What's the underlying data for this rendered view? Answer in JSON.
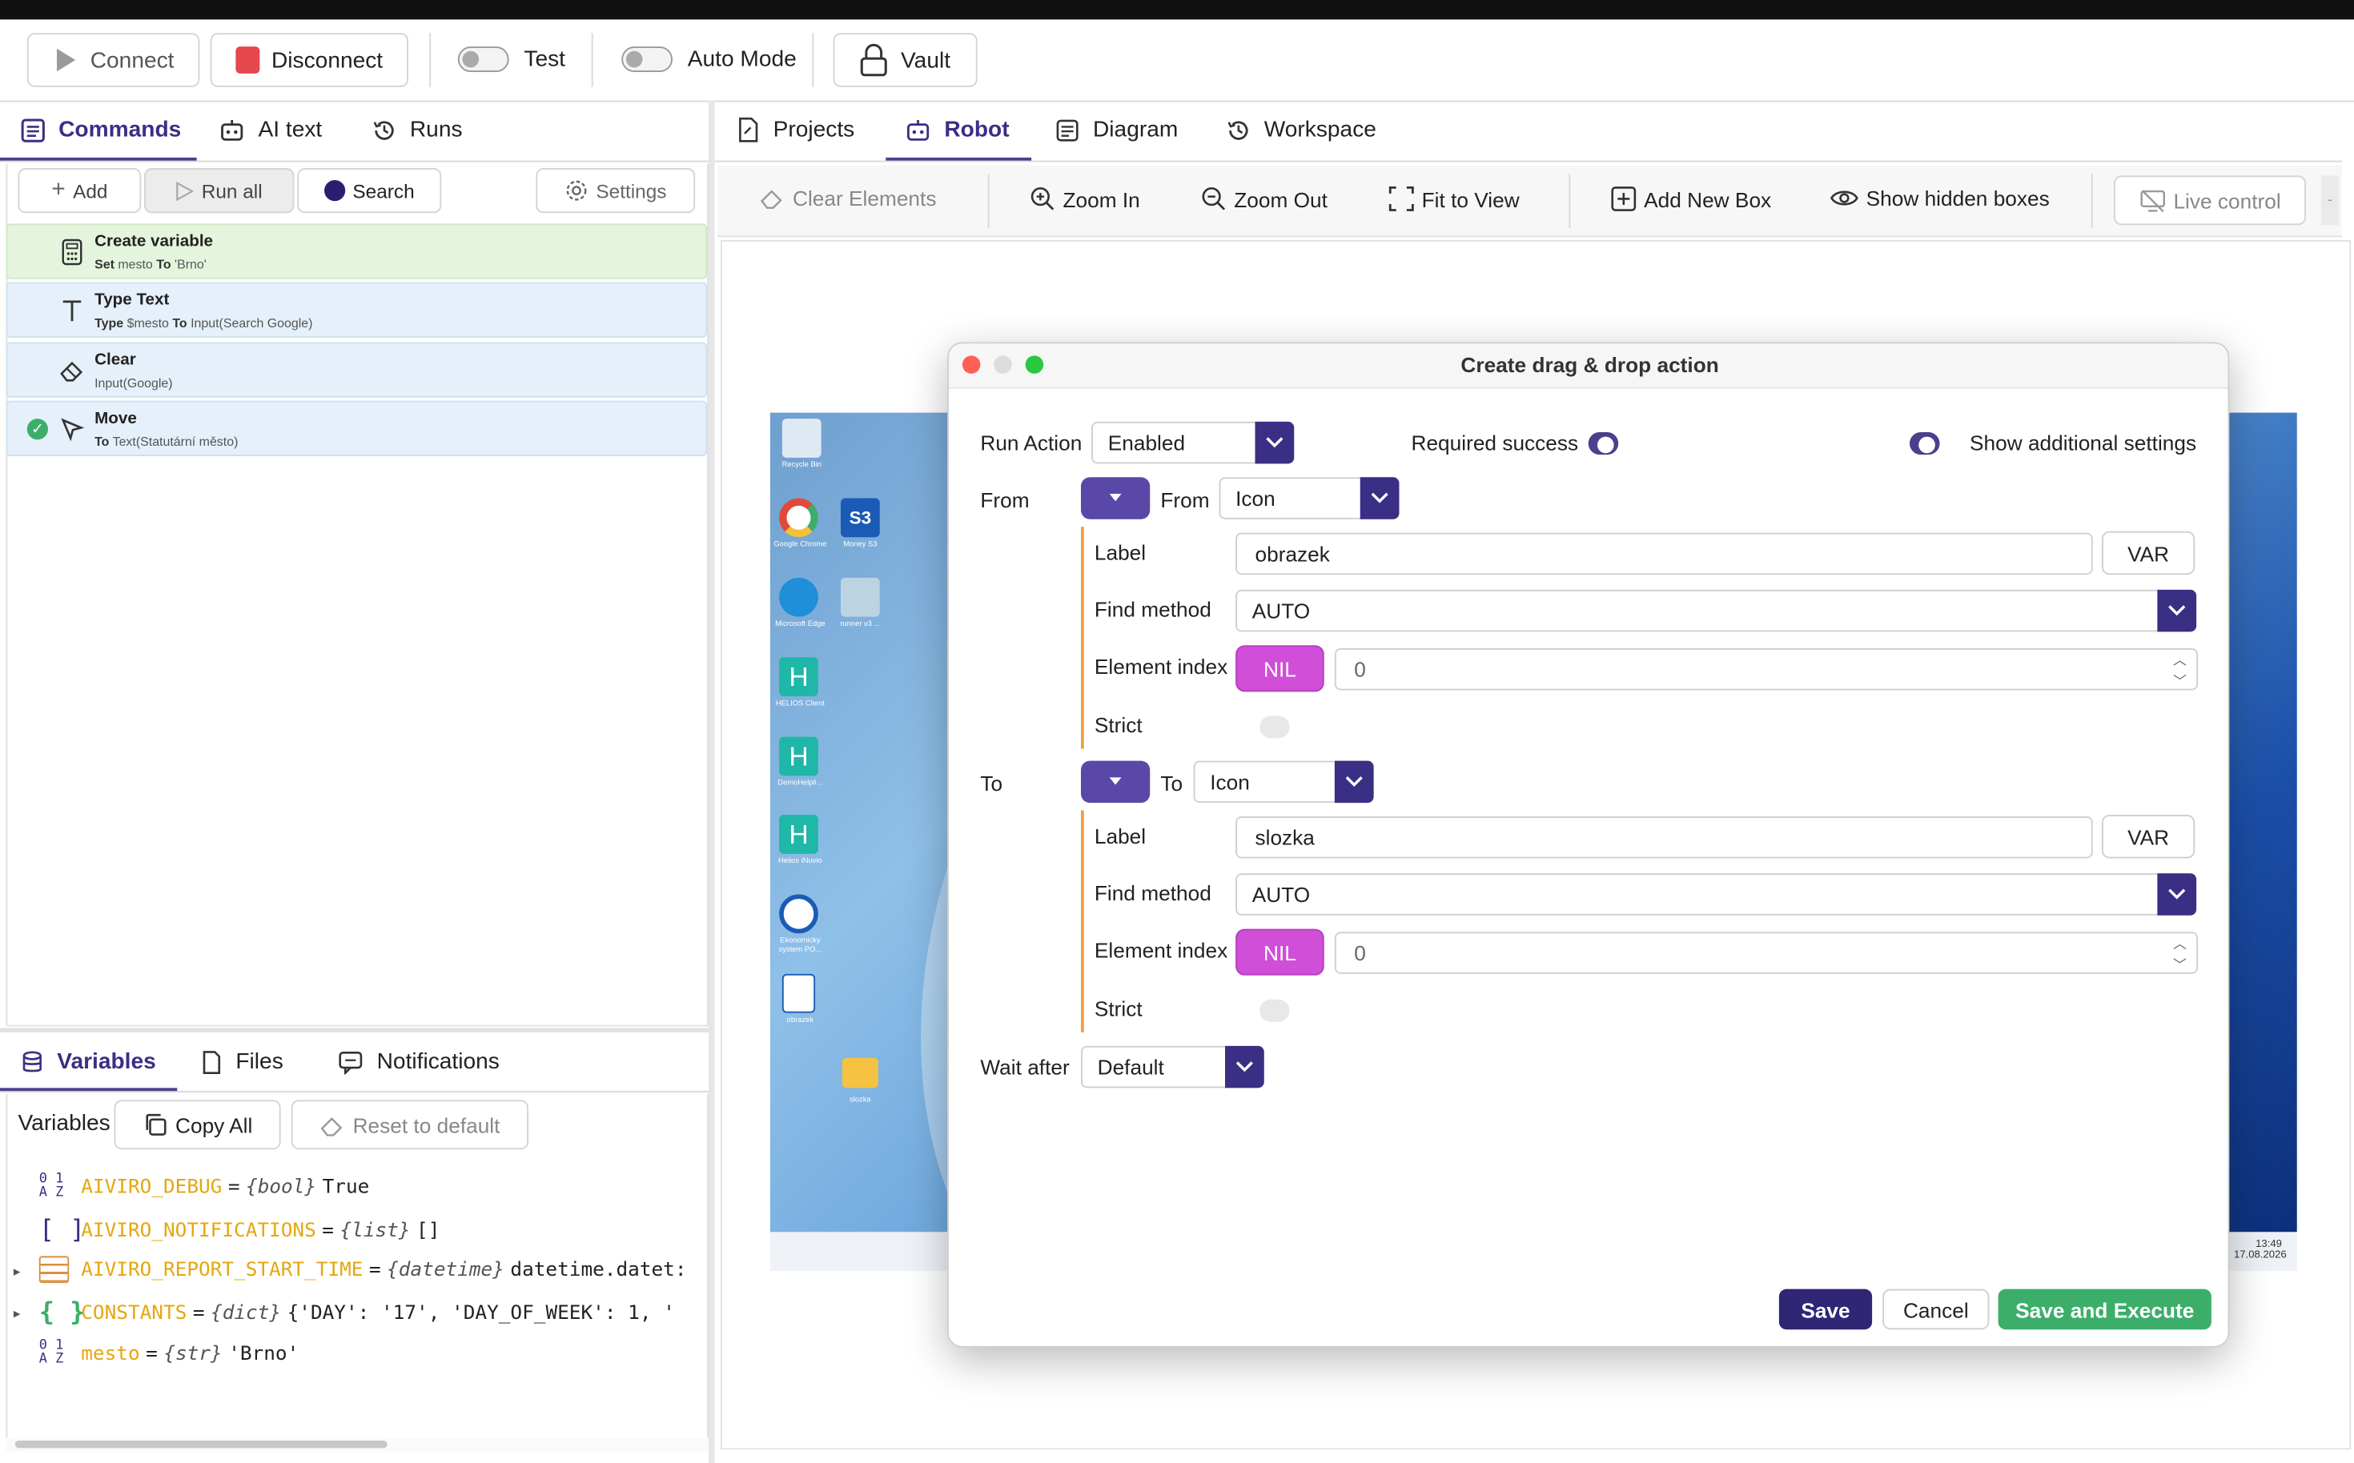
{
  "toolbar": {
    "connect_label": "Connect",
    "disconnect_label": "Disconnect",
    "test_label": "Test",
    "auto_mode_label": "Auto Mode",
    "vault_label": "Vault"
  },
  "left_tabs": [
    "Commands",
    "AI text",
    "Runs"
  ],
  "commands_toolbar": {
    "add_label": "Add",
    "run_all_label": "Run all",
    "search_label": "Search",
    "settings_label": "Settings"
  },
  "commands": [
    {
      "title": "Create variable",
      "sub_kw1": "Set",
      "sub_v1": "mesto",
      "sub_kw2": "To",
      "sub_v2": "'Brno'"
    },
    {
      "title": "Type Text",
      "sub_kw1": "Type",
      "sub_v1": "$mesto",
      "sub_kw2": "To",
      "sub_v2": "Input(Search Google)"
    },
    {
      "title": "Clear",
      "sub_v1": "Input(Google)"
    },
    {
      "title": "Move",
      "sub_kw1": "To",
      "sub_v1": "Text(Statutární město)"
    }
  ],
  "bottom_tabs": [
    "Variables",
    "Files",
    "Notifications"
  ],
  "variables_toolbar": {
    "label": "Variables",
    "copy_all_label": "Copy All",
    "reset_label": "Reset to default"
  },
  "variables": [
    {
      "icon": "01\nAZ",
      "name": "AIVIRO_DEBUG",
      "type": "{bool}",
      "value": "True"
    },
    {
      "icon": "[ ]",
      "name": "AIVIRO_NOTIFICATIONS",
      "type": "{list}",
      "value": "[]"
    },
    {
      "icon": "≡",
      "name": "AIVIRO_REPORT_START_TIME",
      "type": "{datetime}",
      "value": "datetime.datet:"
    },
    {
      "icon": "{ }",
      "name": "CONSTANTS",
      "type": "{dict}",
      "value": "{'DAY': '17', 'DAY_OF_WEEK': 1, '"
    },
    {
      "icon": "01\nAZ",
      "name": "mesto",
      "type": "{str}",
      "value": "'Brno'"
    }
  ],
  "right_tabs": [
    "Projects",
    "Robot",
    "Diagram",
    "Workspace"
  ],
  "robot_toolbar": {
    "clear_elements": "Clear Elements",
    "zoom_in": "Zoom In",
    "zoom_out": "Zoom Out",
    "fit_to_view": "Fit to View",
    "add_new_box": "Add New Box",
    "show_hidden_boxes": "Show hidden boxes",
    "live_control": "Live control"
  },
  "desktop": {
    "icons": [
      "Recycle Bin",
      "Google Chrome",
      "Money S3",
      "Microsoft Edge",
      "runner v3 ...",
      "HELIOS Client",
      "DemoHelpli...",
      "Helios iNuvio",
      "Ekonomicky system PO...",
      "obrazek",
      "slozka"
    ],
    "clock_time": "13:49",
    "clock_date": "17.08.2026"
  },
  "modal": {
    "title": "Create drag & drop action",
    "run_action_label": "Run Action",
    "run_action_value": "Enabled",
    "required_success_label": "Required success",
    "show_additional_label": "Show additional settings",
    "from": {
      "label": "From",
      "type_label": "From",
      "type_value": "Icon",
      "label_field_label": "Label",
      "label_value": "obrazek",
      "var_btn": "VAR",
      "find_method_label": "Find method",
      "find_method_value": "AUTO",
      "element_index_label": "Element index",
      "nil_label": "NIL",
      "element_index_value": "0",
      "strict_label": "Strict"
    },
    "to": {
      "label": "To",
      "type_label": "To",
      "type_value": "Icon",
      "label_field_label": "Label",
      "label_value": "slozka",
      "var_btn": "VAR",
      "find_method_label": "Find method",
      "find_method_value": "AUTO",
      "element_index_label": "Element index",
      "nil_label": "NIL",
      "element_index_value": "0",
      "strict_label": "Strict"
    },
    "wait_after_label": "Wait after",
    "wait_after_value": "Default",
    "save_label": "Save",
    "cancel_label": "Cancel",
    "save_execute_label": "Save and Execute"
  },
  "colors": {
    "accent": "#3a2f85",
    "disconnect_red": "#e5484d",
    "save_execute_green": "#3cae6a",
    "nil_magenta": "#d04ed8",
    "variable_name": "#e5a70f"
  }
}
